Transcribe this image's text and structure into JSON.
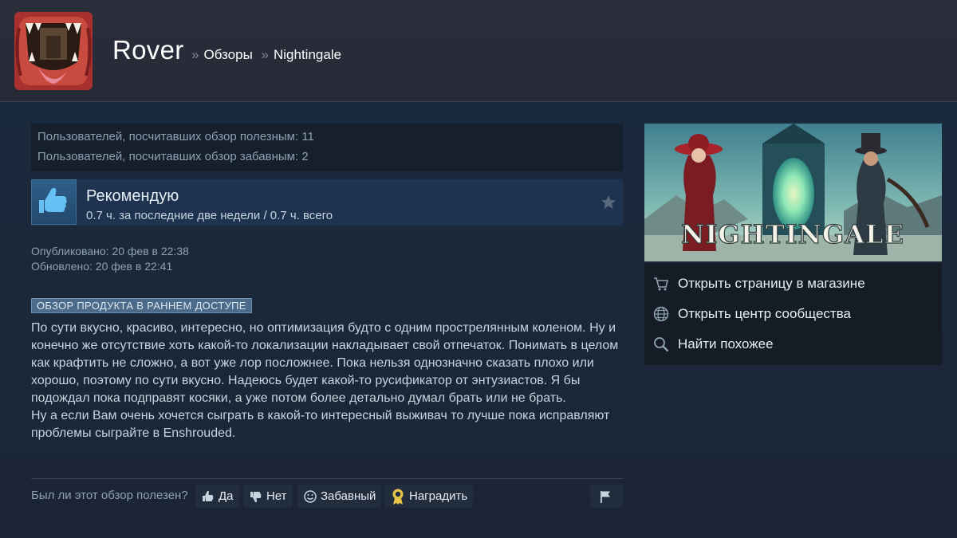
{
  "header": {
    "profile_name": "Rover",
    "breadcrumbs": [
      {
        "sep": "»",
        "label": "Обзоры"
      },
      {
        "sep": "»",
        "label": "Nightingale"
      }
    ]
  },
  "votes": {
    "helpful_text": "Пользователей, посчитавших обзор полезным: 11",
    "funny_text": "Пользователей, посчитавших обзор забавным: 2"
  },
  "recommendation": {
    "title": "Рекомендую",
    "hours": "0.7 ч. за последние две недели / 0.7 ч. всего"
  },
  "dates": {
    "published": "Опубликовано: 20 фев в 22:38",
    "updated": "Обновлено: 20 фев в 22:41"
  },
  "early_access_label": "ОБЗОР ПРОДУКТА В РАННЕМ ДОСТУПЕ",
  "review_paragraphs": [
    "По сути вкусно, красиво, интересно, но оптимизация будто с одним прострелянным коленом. Ну и конечно же отсутствие хоть какой-то локализации накладывает свой отпечаток. Понимать в целом как крафтить не сложно, а вот уже лор посложнее. Пока нельзя однозначно сказать плохо или хорошо, поэтому по сути вкусно. Надеюсь будет какой-то русификатор от энтузиастов. Я бы подождал пока подправят косяки, а уже потом более детально думал брать или не брать.",
    "Ну а если Вам очень хочется сыграть в какой-то интересный выживач то лучше пока исправляют проблемы сыграйте в Enshrouded."
  ],
  "helpful_bar": {
    "question": "Был ли этот обзор полезен?",
    "yes": "Да",
    "no": "Нет",
    "funny": "Забавный",
    "award": "Наградить"
  },
  "sidebar": {
    "game_logo_text": "NIGHTINGALE",
    "links": [
      {
        "label": "Открыть страницу в магазине",
        "icon": "cart-icon"
      },
      {
        "label": "Открыть центр сообщества",
        "icon": "globe-icon"
      },
      {
        "label": "Найти похожее",
        "icon": "search-icon"
      }
    ]
  },
  "colors": {
    "background": "#1b2838",
    "accent": "#4c6b8a",
    "text": "#c6d4df"
  }
}
